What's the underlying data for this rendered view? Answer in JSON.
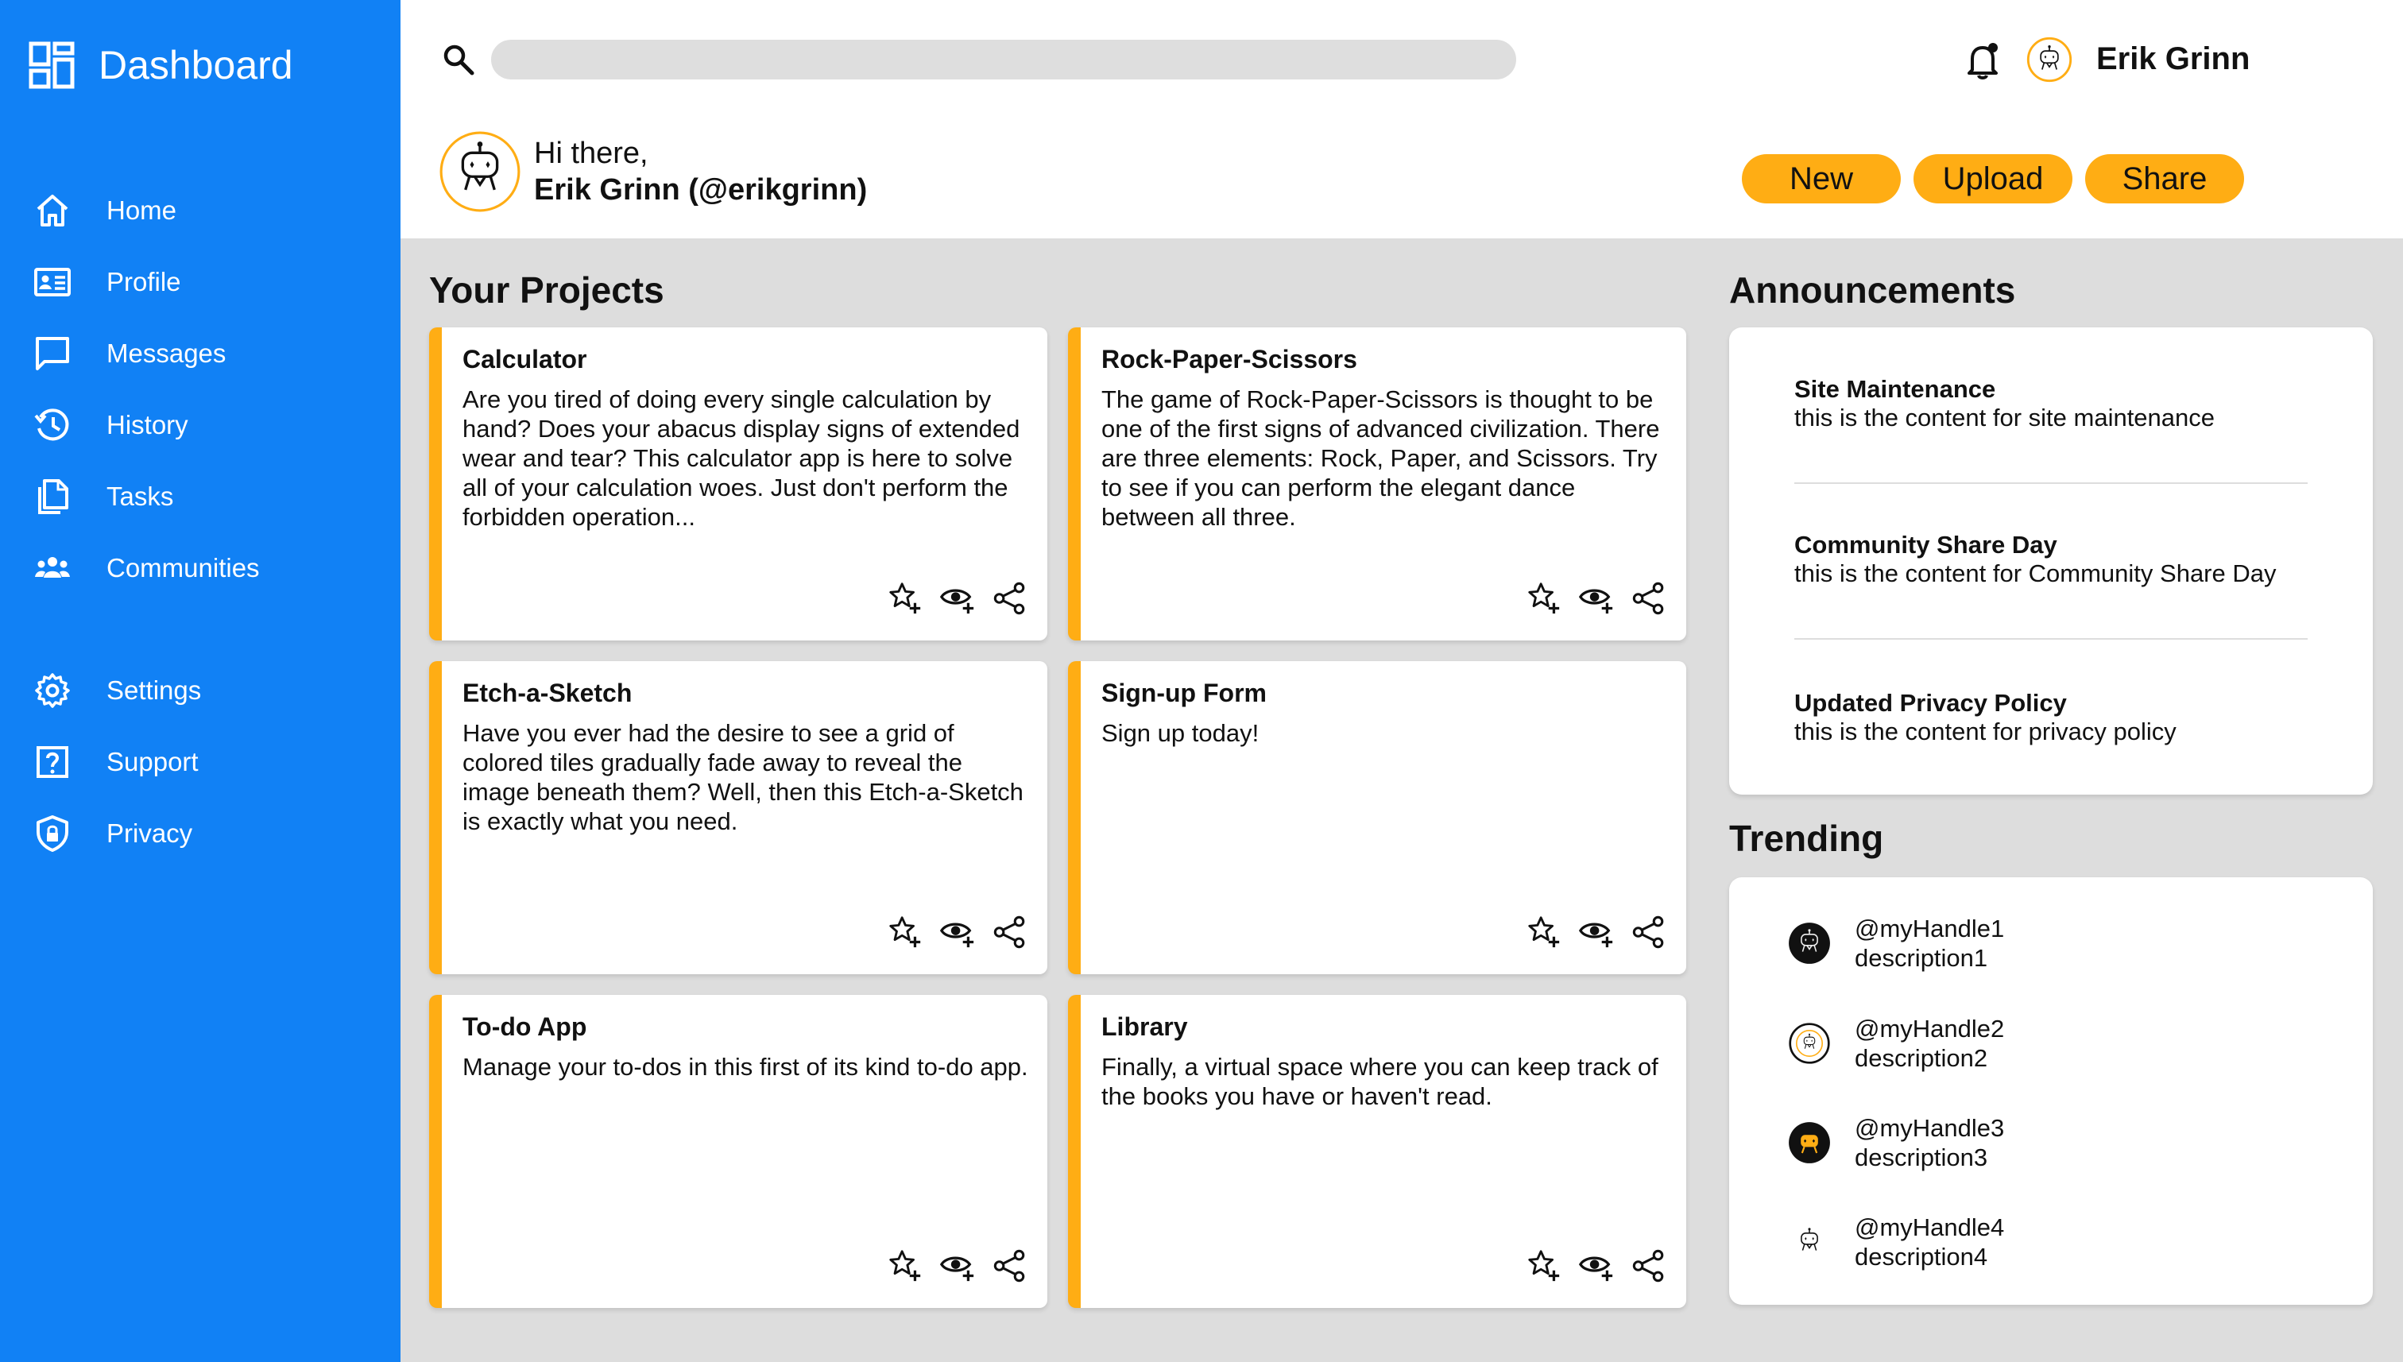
{
  "sidebar": {
    "title": "Dashboard",
    "items": [
      {
        "label": "Home",
        "icon": "home-icon"
      },
      {
        "label": "Profile",
        "icon": "id-card-icon"
      },
      {
        "label": "Messages",
        "icon": "chat-icon"
      },
      {
        "label": "History",
        "icon": "history-icon"
      },
      {
        "label": "Tasks",
        "icon": "documents-icon"
      },
      {
        "label": "Communities",
        "icon": "people-icon"
      }
    ],
    "bottom_items": [
      {
        "label": "Settings",
        "icon": "gear-icon"
      },
      {
        "label": "Support",
        "icon": "help-icon"
      },
      {
        "label": "Privacy",
        "icon": "shield-icon"
      }
    ]
  },
  "header": {
    "search_placeholder": "",
    "user_name": "Erik Grinn",
    "greeting": "Hi there,",
    "greeting_name": "Erik Grinn (@erikgrinn)",
    "buttons": {
      "new": "New",
      "upload": "Upload",
      "share": "Share"
    }
  },
  "projects": {
    "title": "Your Projects",
    "cards": [
      {
        "title": "Calculator",
        "desc": "Are you tired of doing every single calculation by hand? Does your abacus display signs of extended wear and tear? This calculator app is here to solve all of your calculation woes. Just don't perform the forbidden operation..."
      },
      {
        "title": "Rock-Paper-Scissors",
        "desc": "The game of Rock-Paper-Scissors is thought to be one of the first signs of advanced civilization. There are three elements: Rock, Paper, and Scissors. Try to see if you can perform the elegant dance between all three."
      },
      {
        "title": "Etch-a-Sketch",
        "desc": "Have you ever had the desire to see a grid of colored tiles gradually fade away to reveal the image beneath them? Well, then this Etch-a-Sketch is exactly what you need."
      },
      {
        "title": "Sign-up Form",
        "desc": "Sign up today!"
      },
      {
        "title": "To-do App",
        "desc": "Manage your to-dos in this first of its kind to-do app."
      },
      {
        "title": "Library",
        "desc": "Finally, a virtual space where you can keep track of the books you have or haven't read."
      }
    ]
  },
  "announcements": {
    "title": "Announcements",
    "items": [
      {
        "title": "Site Maintenance",
        "text": "this is the content for site maintenance"
      },
      {
        "title": "Community Share Day",
        "text": "this is the content for Community Share Day"
      },
      {
        "title": "Updated Privacy Policy",
        "text": "this is the content for privacy policy"
      }
    ]
  },
  "trending": {
    "title": "Trending",
    "items": [
      {
        "handle": "@myHandle1",
        "desc": "description1"
      },
      {
        "handle": "@myHandle2",
        "desc": "description2"
      },
      {
        "handle": "@myHandle3",
        "desc": "description3"
      },
      {
        "handle": "@myHandle4",
        "desc": "description4"
      }
    ]
  },
  "colors": {
    "sidebar": "#1181f5",
    "accent": "#ffad14",
    "background": "#dddddd",
    "card": "#ffffff"
  }
}
